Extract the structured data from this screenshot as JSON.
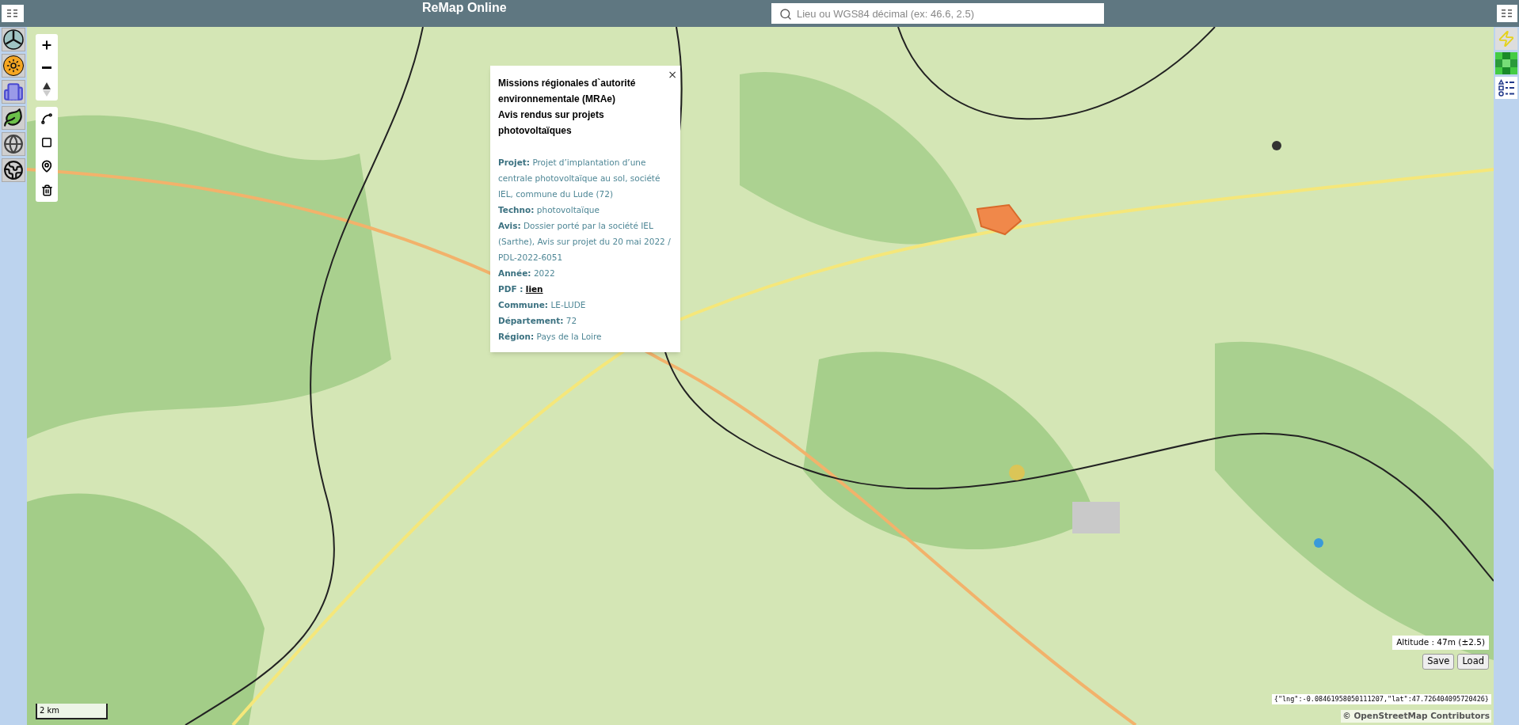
{
  "header": {
    "title": "ReMap Online",
    "search": {
      "placeholder": "Lieu ou WGS84 décimal (ex: 46.6, 2.5)"
    }
  },
  "popup": {
    "close": "×",
    "title": [
      "Missions régionales d`autorité environnementale (MRAe)",
      "Avis rendus sur projets photovoltaïques"
    ],
    "fields": [
      {
        "kind": "text",
        "label": "Projet:",
        "value": "Projet d’implantation d’une centrale photovoltaïque au sol, société IEL, commune du Lude (72)"
      },
      {
        "kind": "text",
        "label": "Techno:",
        "value": "photovoltaïque"
      },
      {
        "kind": "text",
        "label": "Avis:",
        "value": "Dossier porté par la société IEL (Sarthe), Avis sur projet du 20 mai 2022 / PDL-2022-6051"
      },
      {
        "kind": "text",
        "label": "Année:",
        "value": "2022"
      },
      {
        "kind": "link",
        "label": "PDF :",
        "value": "lien"
      },
      {
        "kind": "text",
        "label": "Commune:",
        "value": "LE-LUDE"
      },
      {
        "kind": "text",
        "label": "Département:",
        "value": "72"
      },
      {
        "kind": "text",
        "label": "Région:",
        "value": "Pays de la Loire"
      }
    ]
  },
  "altitude": "Altitude : 47m (±2.5)",
  "buttons": [
    "Save",
    "Load"
  ],
  "coordinates": "{\"lng\":-0.08461958050111207,\"lat\":47.726404095720426}",
  "attribution": "© OpenStreetMap Contributors",
  "scale": "2 km"
}
